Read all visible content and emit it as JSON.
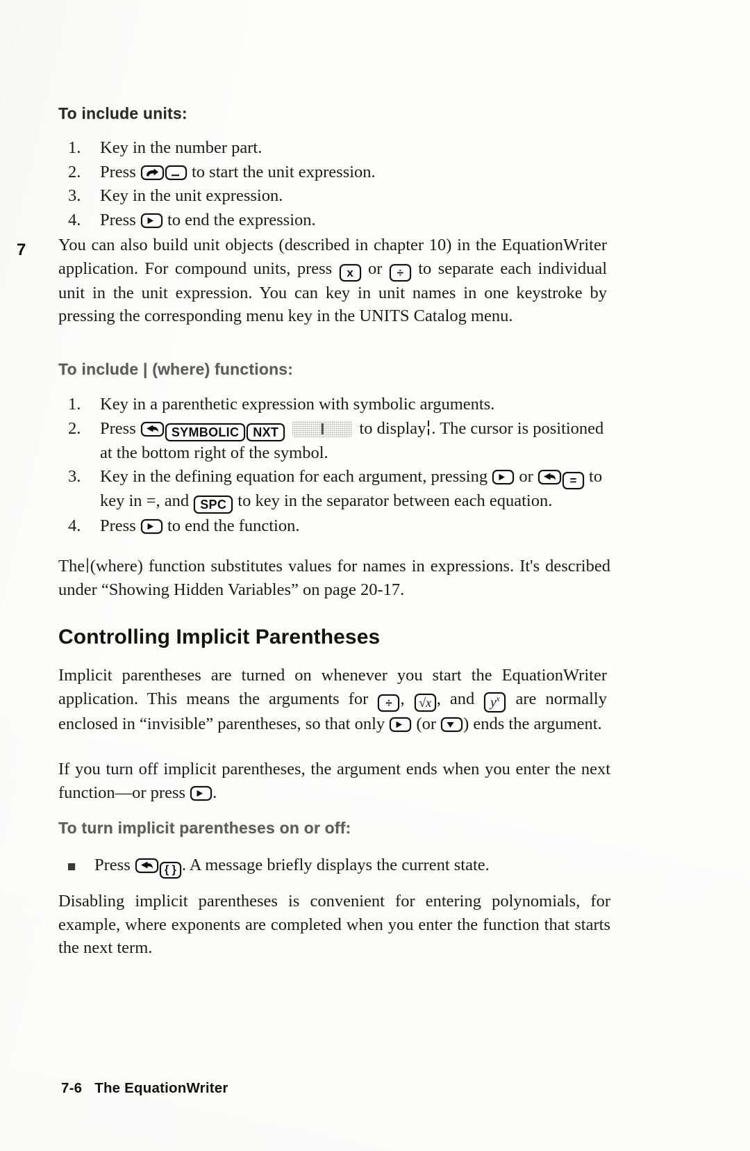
{
  "page": {
    "chapter_tab": "7",
    "footer": {
      "page_number": "7-6",
      "section_title": "The EquationWriter"
    }
  },
  "sections": {
    "units": {
      "heading": "To include units:",
      "steps": [
        {
          "num": "1.",
          "text": "Key in the number part."
        },
        {
          "num": "2.",
          "pre": "Press",
          "keys": [
            "right-shift",
            "underscore"
          ],
          "post": "to start the unit expression."
        },
        {
          "num": "3.",
          "text": "Key in the unit expression."
        },
        {
          "num": "4.",
          "pre": "Press",
          "keys": [
            "right-arrow"
          ],
          "post": "to end the expression."
        }
      ],
      "body_part1": "You can also build unit objects (described in chapter 10) in the EquationWriter application. For compound units, press",
      "key_times": "x",
      "body_or": "or",
      "key_divide": "÷",
      "body_part2": "to separate each individual unit in the unit expression. You can key in unit names in one keystroke by pressing the corresponding menu key in the UNITS Catalog menu."
    },
    "where": {
      "heading": "To include | (where) functions:",
      "steps": [
        {
          "num": "1.",
          "text": "Key in a parenthetic expression with symbolic arguments."
        },
        {
          "num": "2.",
          "pre": "Press",
          "key_leftshift": "left-shift",
          "key_symbolic": "SYMBOLIC",
          "key_nxt": "NXT",
          "key_menu_faded": "menu-key-where",
          "mid": "to display",
          "post": ". The cursor is positioned at the bottom right of the symbol."
        },
        {
          "num": "3.",
          "pre": "Key in the defining equation for each argument, pressing",
          "key_rightarrow": "right-arrow",
          "or": "or",
          "key_leftshift": "left-shift",
          "key_equals": "=",
          "mid": "to key in =, and",
          "key_spc": "SPC",
          "post": "to key in the separator between each equation."
        },
        {
          "num": "4.",
          "pre": "Press",
          "keys": [
            "right-arrow"
          ],
          "post": "to end the function."
        }
      ],
      "closing_pre": "The",
      "closing_post": "(where) function substitutes values for names in expressions. It's described under “Showing Hidden Variables” on page 20-17."
    },
    "implicit": {
      "heading": "Controlling Implicit Parentheses",
      "para1_a": "Implicit parentheses are turned on whenever you start the EquationWriter application. This means the arguments for",
      "key_divide": "÷",
      "para1_comma": ",",
      "key_sqrt": "√x",
      "para1_b": ", and",
      "key_ypowx": "y",
      "key_ypowx_sup": "x",
      "para1_c": "are normally enclosed in “invisible” parentheses, so that only",
      "key_rightarrow": "right-arrow",
      "para1_d": "(or",
      "key_downarrow": "down-arrow",
      "para1_e": ") ends the argument.",
      "para2": "If you turn off implicit parentheses, the argument ends when you enter the next function—or press",
      "para2_key": "right-arrow",
      "para2_end": ".",
      "subheading": "To turn implicit parentheses on or off:",
      "bullet_pre": "Press",
      "bullet_key_leftshift": "left-shift",
      "bullet_key_braces": "{ }",
      "bullet_post": ". A message briefly displays the current state.",
      "para3": "Disabling implicit parentheses is convenient for entering polynomials, for example, where exponents are completed when you enter the function that starts the next term."
    }
  },
  "colors": {
    "ink": "#1b1b1b",
    "paper": "#fdfdfc",
    "faded_ink": "#5d5d5d"
  }
}
